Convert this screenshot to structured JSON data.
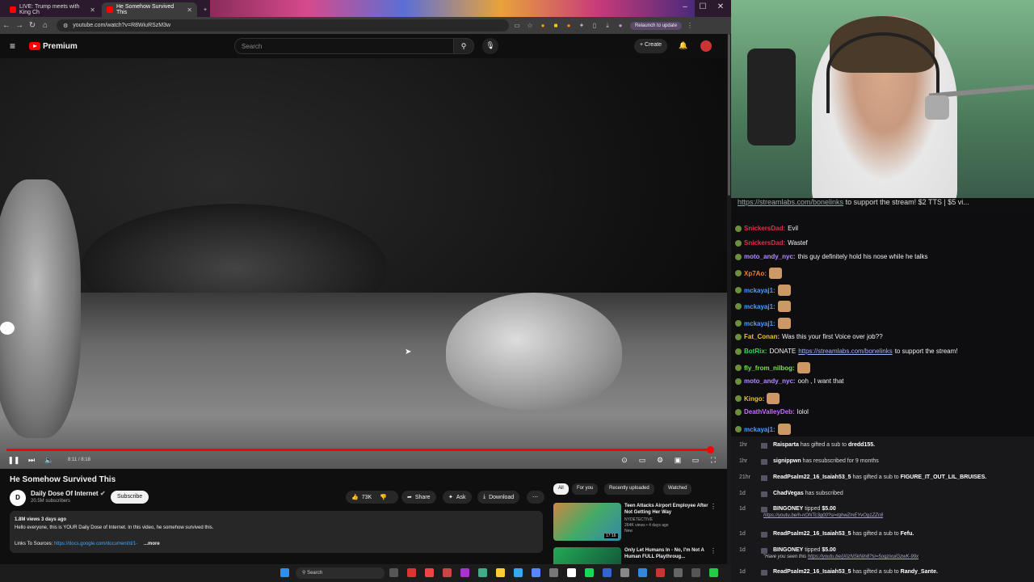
{
  "browser": {
    "tabs": [
      {
        "title": "LIVE: Trump meets with King Ch"
      },
      {
        "title": "He Somehow Survived This"
      }
    ],
    "url": "youtube.com/watch?v=R8WiuRSzM3w",
    "relaunch": "Relaunch to update"
  },
  "youtube": {
    "brand": "Premium",
    "search_placeholder": "Search",
    "create_label": "Create",
    "video": {
      "time": "8:11 / 8:18",
      "progress": 0.986
    },
    "title": "He Somehow Survived This",
    "channel": {
      "name": "Daily Dose Of Internet",
      "initials": "D",
      "subscribers": "20.5M subscribers"
    },
    "subscribe_label": "Subscribe",
    "actions": {
      "likes": "73K",
      "share": "Share",
      "ask": "Ask",
      "download": "Download"
    },
    "description": {
      "meta": "1.8M views  3 days ago",
      "text": "Hello everyone, this is YOUR Daily Dose of Internet. In this video, he somehow survived this.",
      "links_label": "Links To Sources:",
      "link": "https://docs.google.com/document/d/1-",
      "more": "...more"
    },
    "chips": [
      "All",
      "For you",
      "Recently uploaded",
      "Watched"
    ],
    "recommended": [
      {
        "title": "Teen Attacks Airport Employee After Not Getting Her Way",
        "channel": "NYDETECTIVE",
        "meta": "264K views • 4 days ago",
        "badge": "New",
        "duration": "17:16"
      },
      {
        "title": "Only Let Humans In - No, I'm Not A Human FULL Playthroug...",
        "channel": "",
        "meta": "",
        "badge": "",
        "duration": ""
      }
    ]
  },
  "taskbar": {
    "search": "Search"
  },
  "stream": {
    "ticker_link": "https://streamlabs.com/bonelinks",
    "ticker_text": " to support the stream! $2 TTS | $5 vi...",
    "chat": [
      {
        "user": "SnickersDad:",
        "text": "Evil",
        "color": "#e0304a"
      },
      {
        "user": "SnickersDad:",
        "text": "Wastef",
        "color": "#e0304a"
      },
      {
        "user": "moto_andy_nyc:",
        "text": "this guy definitely hold his nose while he talks",
        "color": "#b28cff"
      },
      {
        "user": "Xp7Ao:",
        "text": "",
        "color": "#ff7a2a",
        "emote": true
      },
      {
        "user": "mckayaj1:",
        "text": "",
        "color": "#4a9cff",
        "emote": true
      },
      {
        "user": "mckayaj1:",
        "text": "",
        "color": "#4a9cff",
        "emote": true
      },
      {
        "user": "mckayaj1:",
        "text": "",
        "color": "#4a9cff",
        "emote": true
      },
      {
        "user": "Fat_Conan:",
        "text": "Was this your first Voice over job??",
        "color": "#e8c32a"
      },
      {
        "user": "BotRix:",
        "text": "DONATE",
        "color": "#3ad45a",
        "link": "https://streamlabs.com/bonelinks",
        "after": " to support the stream!"
      },
      {
        "user": "fly_from_nilbog:",
        "text": "",
        "color": "#7be04a",
        "emote": true
      },
      {
        "user": "moto_andy_nyc:",
        "text": "ooh , I want that",
        "color": "#b28cff"
      },
      {
        "user": "Kingo:",
        "text": "",
        "color": "#e8c32a",
        "emote": true
      },
      {
        "user": "DeathValleyDeb:",
        "text": "lolol",
        "color": "#c86bff"
      },
      {
        "user": "mckayaj1:",
        "text": "",
        "color": "#4a9cff",
        "emote": true
      }
    ],
    "events": [
      {
        "time": "1hr",
        "user": "Raisparta",
        "text": " has gifted a sub to ",
        "target": "dredd155."
      },
      {
        "time": "1hr",
        "user": "signippwn",
        "text": " has resubscribed for 9 months",
        "target": ""
      },
      {
        "time": "21hr",
        "user": "ReadPsalm22_16_Isaiah53_5",
        "text": " has gifted a sub to ",
        "target": "FIGURE_IT_OUT_LIL_BRUISES."
      },
      {
        "time": "1d",
        "user": "ChadVegas",
        "text": " has subscribed",
        "target": ""
      },
      {
        "time": "1d",
        "user": "BINGONEY",
        "text": " tipped ",
        "target": "$5.00",
        "sub": "https://youtu.be/h-nONTc3g00?si=tqhwZmEYvOg1ZZc8"
      },
      {
        "time": "1d",
        "user": "ReadPsalm22_16_Isaiah53_5",
        "text": " has gifted a sub to ",
        "target": "Fefu."
      },
      {
        "time": "1d",
        "user": "BINGONEY",
        "text": " tipped ",
        "target": "$5.00",
        "sub_prefix": "\"Have you seen this ",
        "sub": "https://youtu.be/jXIzNSkNln8?si=5oqzixuiGzwK-99x"
      },
      {
        "time": "1d",
        "user": "ReadPsalm22_16_Isaiah53_5",
        "text": " has gifted a sub to ",
        "target": "Randy_Sante."
      }
    ]
  }
}
